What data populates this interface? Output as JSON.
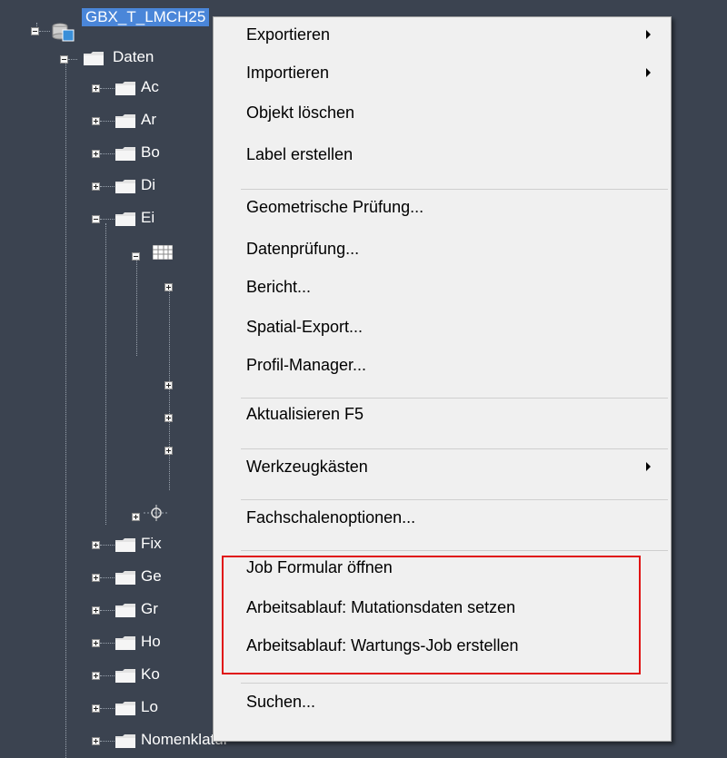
{
  "tree": {
    "root_label": "GBX_T_LMCH25",
    "datenbank_label": "Daten",
    "folders_group1": [
      "Ac",
      "Ar",
      "Bo",
      "Di",
      "Ei"
    ],
    "folders_group2": [
      "Fix",
      "Ge",
      "Gr",
      "Ho",
      "Ko",
      "Lo",
      "Nomenklatur"
    ]
  },
  "menu": {
    "items": [
      {
        "label": "Exportieren",
        "submenu": true
      },
      {
        "label": "Importieren",
        "submenu": true
      },
      {
        "label": "Objekt löschen"
      },
      {
        "label": "Label erstellen"
      },
      {
        "label": "Geometrische Prüfung..."
      },
      {
        "label": "Datenprüfung..."
      },
      {
        "label": "Bericht..."
      },
      {
        "label": "Spatial-Export..."
      },
      {
        "label": "Profil-Manager..."
      },
      {
        "label": "Aktualisieren F5"
      },
      {
        "label": "Werkzeugkästen",
        "submenu": true
      },
      {
        "label": "Fachschalenoptionen..."
      },
      {
        "label": "Job Formular öffnen"
      },
      {
        "label": "Arbeitsablauf: Mutationsdaten setzen"
      },
      {
        "label": "Arbeitsablauf: Wartungs-Job erstellen"
      },
      {
        "label": "Suchen..."
      }
    ]
  },
  "colors": {
    "background": "#3b4350",
    "menu_background": "#f0f0f0",
    "selection": "#4a86d9",
    "highlight_border": "#e01414"
  },
  "icons": {
    "root": "database-icon",
    "folder": "folder-icon",
    "table": "table-icon",
    "feature": "point-feature-icon",
    "submenu": "chevron-right-icon"
  }
}
